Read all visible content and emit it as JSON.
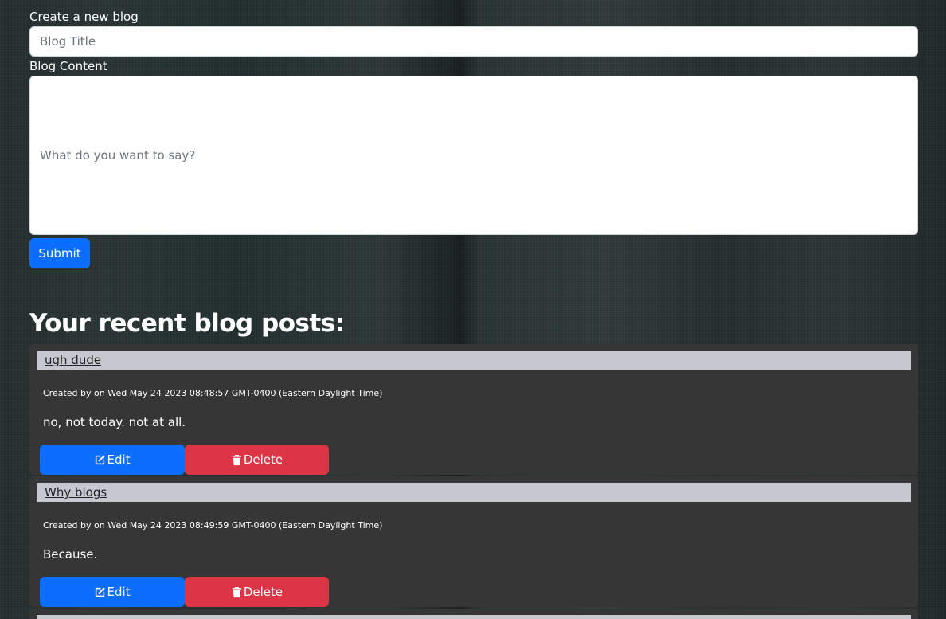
{
  "form": {
    "title_label": "Create a new blog",
    "title_placeholder": "Blog Title",
    "title_value": "",
    "content_label": "Blog Content",
    "content_placeholder": "What do you want to say?",
    "content_value": "",
    "submit_label": "Submit"
  },
  "recent": {
    "heading": "Your recent blog posts:"
  },
  "posts": [
    {
      "title": "ugh dude",
      "meta": "Created by on Wed May 24 2023 08:48:57 GMT-0400 (Eastern Daylight Time)",
      "body": "no, not today. not at all.",
      "edit_label": "Edit",
      "edit_icon": "edit-icon",
      "delete_label": "Delete",
      "delete_icon": "trash-icon"
    },
    {
      "title": "Why blogs",
      "meta": "Created by on Wed May 24 2023 08:49:59 GMT-0400 (Eastern Daylight Time)",
      "body": "Because.",
      "edit_label": "Edit",
      "edit_icon": "edit-icon",
      "delete_label": "Delete",
      "delete_icon": "trash-icon"
    }
  ],
  "colors": {
    "primary": "#0d6efd",
    "danger": "#dc3545",
    "card": "#363636",
    "title_bar": "#c7c7d0"
  }
}
